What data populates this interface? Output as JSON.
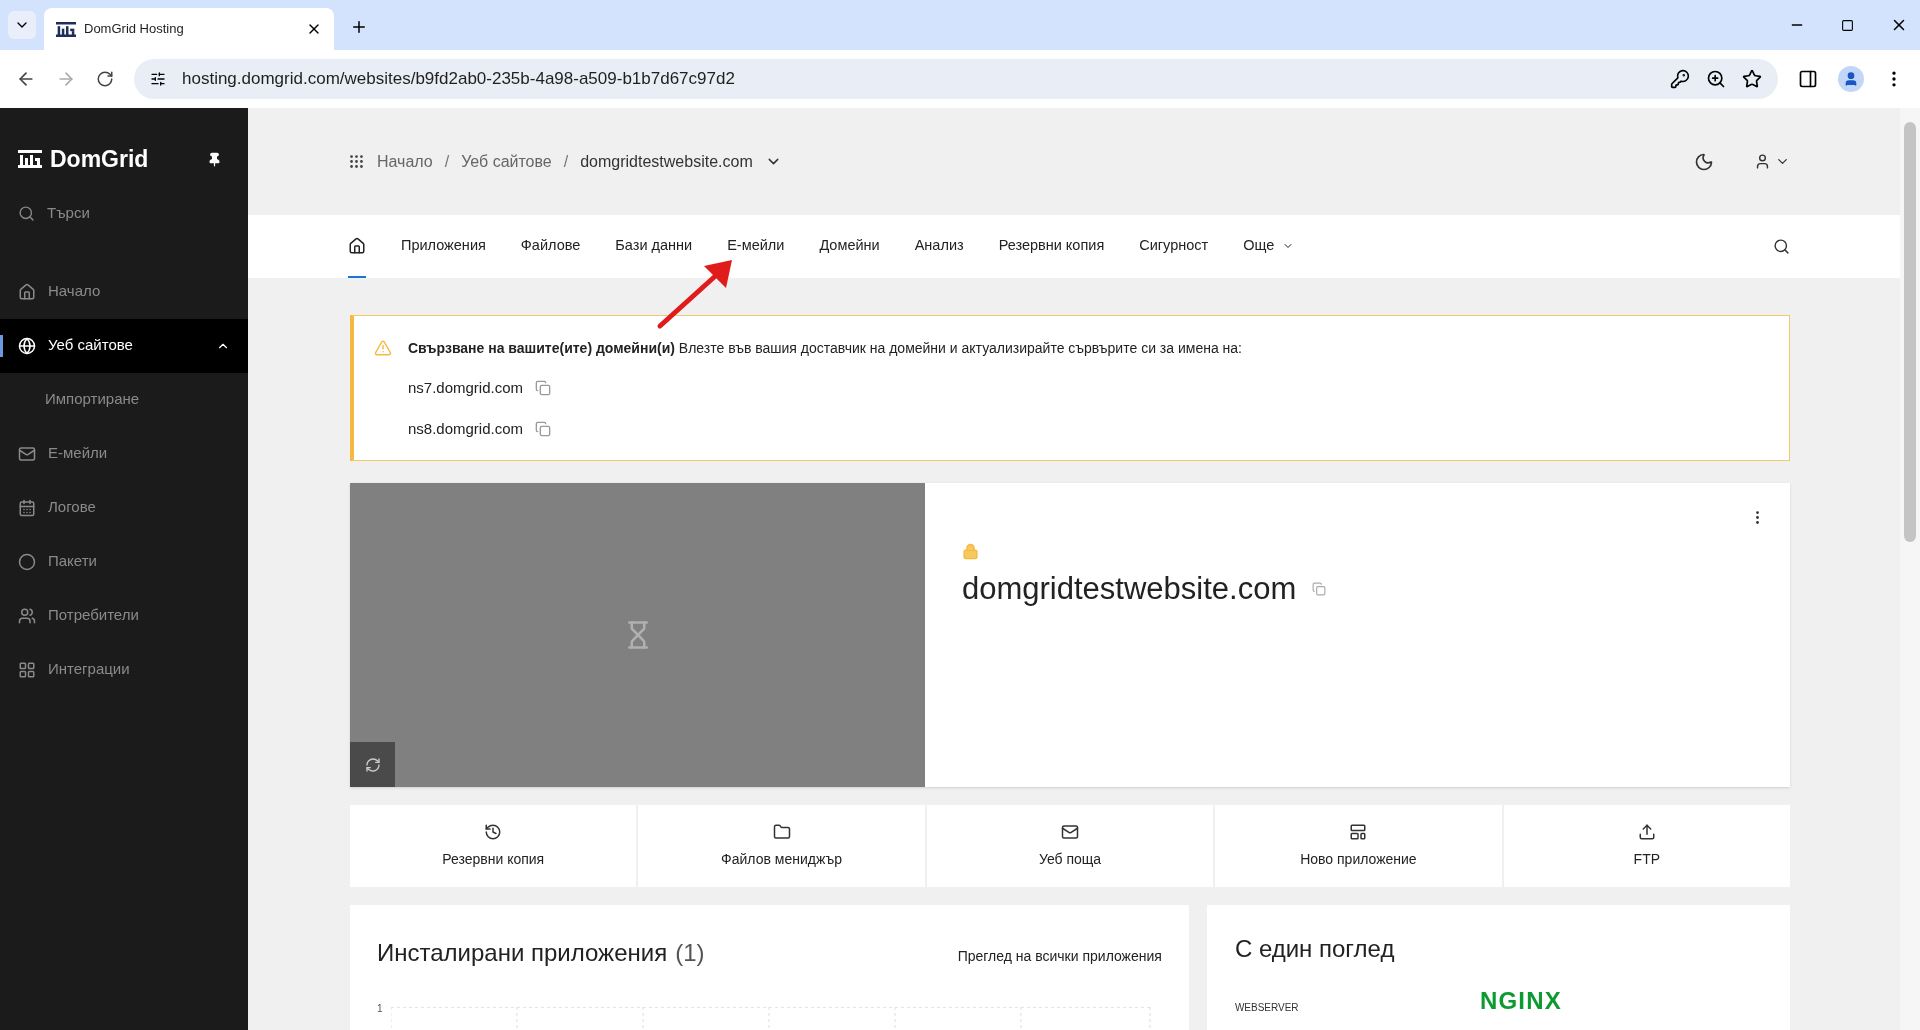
{
  "browser": {
    "tab_title": "DomGrid Hosting",
    "url": "hosting.domgrid.com/websites/b9fd2ab0-235b-4a98-a509-b1b7d67c97d2"
  },
  "sidebar": {
    "brand": "DomGrid",
    "search": "Търси",
    "items": [
      {
        "label": "Начало",
        "selected": false
      },
      {
        "label": "Уеб сайтове",
        "selected": true,
        "expanded": true,
        "children": [
          {
            "label": "Импортиране",
            "selected": false
          }
        ]
      },
      {
        "label": "Е-мейли",
        "selected": false
      },
      {
        "label": "Логове",
        "selected": false
      },
      {
        "label": "Пакети",
        "selected": false
      },
      {
        "label": "Потребители",
        "selected": false
      },
      {
        "label": "Интеграции",
        "selected": false
      }
    ]
  },
  "breadcrumbs": [
    {
      "label": "Начало"
    },
    {
      "separator": "/",
      "label": "Уеб сайтове"
    },
    {
      "separator": "/",
      "label": "domgridtestwebsite.com"
    }
  ],
  "tabs": [
    {
      "kind": "home",
      "selected": true
    },
    {
      "kind": "text",
      "label": "Приложения",
      "selected": false
    },
    {
      "kind": "text",
      "label": "Файлове",
      "selected": false
    },
    {
      "kind": "text",
      "label": "Бази данни",
      "selected": false
    },
    {
      "kind": "text",
      "label": "Е-мейли",
      "selected": false
    },
    {
      "kind": "text",
      "label": "Домейни",
      "selected": false
    },
    {
      "kind": "text",
      "label": "Анализ",
      "selected": false
    },
    {
      "kind": "text",
      "label": "Резервни копия",
      "selected": false
    },
    {
      "kind": "text",
      "label": "Сигурност",
      "selected": false
    },
    {
      "kind": "menu",
      "label": "Още",
      "selected": false
    }
  ],
  "alert": {
    "message": "**Свързване на вашите(ите) домейни(и)** Влезте във вашия доставчик на домейни и актуализирайте сървърите си за имена на:",
    "nameservers": [
      "ns7.domgrid.com",
      "ns8.domgrid.com"
    ]
  },
  "site": {
    "domain": "domgridtestwebsite.com",
    "ssl": true
  },
  "quick_actions": [
    {
      "label": "Резервни копия"
    },
    {
      "label": "Файлов мениджър"
    },
    {
      "label": "Уеб поща"
    },
    {
      "label": "Ново приложение"
    },
    {
      "label": "FTP"
    }
  ],
  "installed_apps": {
    "title": "Инсталирани приложения",
    "count": "(1)",
    "link": "Преглед на всички приложения",
    "axis_tick": "1"
  },
  "overview": {
    "title": "С един поглед",
    "row_label": "WEBSERVER",
    "row_value": "NGINX"
  }
}
